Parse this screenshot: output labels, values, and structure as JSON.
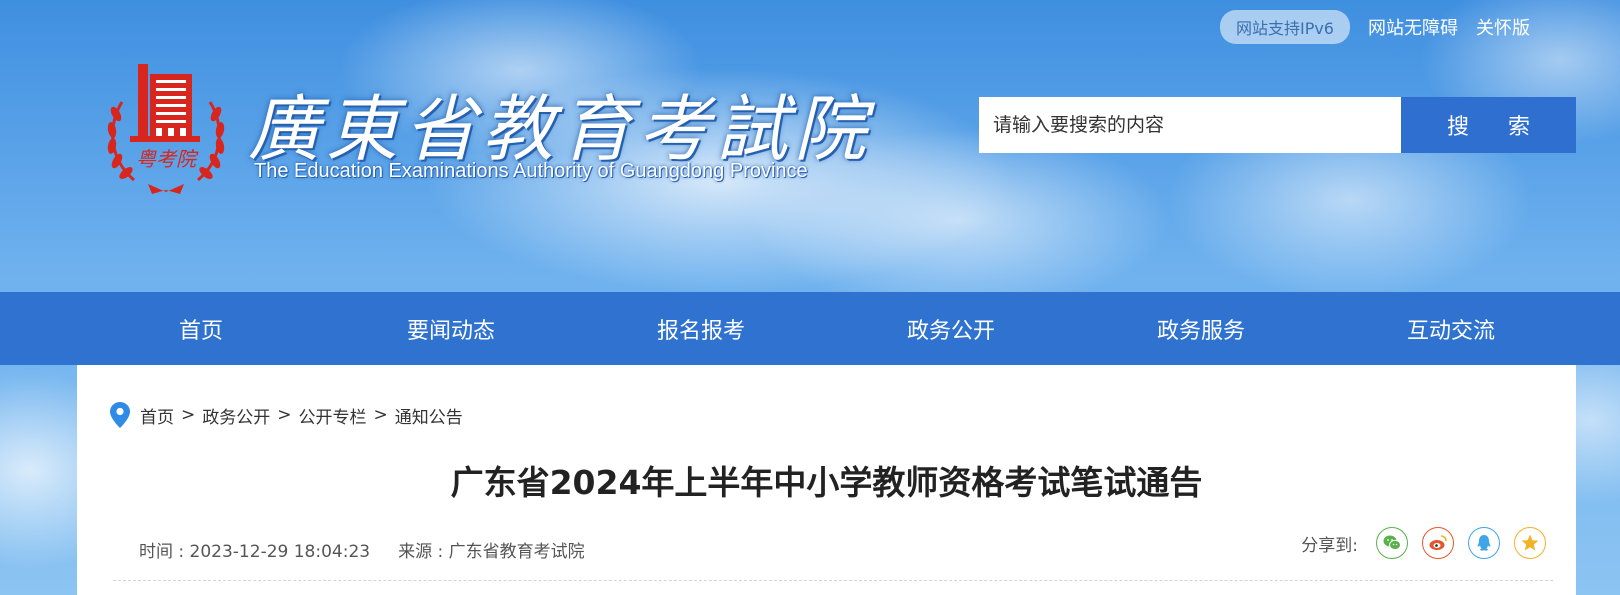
{
  "header": {
    "top_links": {
      "ipv6": "网站支持IPv6",
      "accessibility": "网站无障碍",
      "care_mode": "关怀版"
    },
    "logo": {
      "name_cn": "廣東省教育考試院",
      "name_en": "The Education Examinations Authority of Guangdong Province",
      "emblem_text": "粤考院"
    },
    "search": {
      "placeholder": "请输入要搜索的内容",
      "button_label": "搜 索"
    }
  },
  "nav": {
    "items": [
      {
        "label": "首页"
      },
      {
        "label": "要闻动态"
      },
      {
        "label": "报名报考"
      },
      {
        "label": "政务公开"
      },
      {
        "label": "政务服务"
      },
      {
        "label": "互动交流"
      }
    ]
  },
  "breadcrumb": {
    "items": [
      "首页",
      "政务公开",
      "公开专栏",
      "通知公告"
    ],
    "separator": ">"
  },
  "article": {
    "title": "广东省2024年上半年中小学教师资格考试笔试通告",
    "time": "时间 : 2023-12-29 18:04:23",
    "source": "来源 : 广东省教育考试院"
  },
  "share": {
    "label": "分享到:",
    "icons": [
      "wechat-icon",
      "weibo-icon",
      "qq-icon",
      "qzone-icon"
    ]
  },
  "colors": {
    "nav_bg": "#2f72d0",
    "search_button": "#2f6fd0",
    "emblem_red": "#d8261e",
    "wechat": "#5ab04a",
    "weibo": "#e4572e",
    "qq": "#3ea6e8",
    "qzone": "#f2b327"
  }
}
